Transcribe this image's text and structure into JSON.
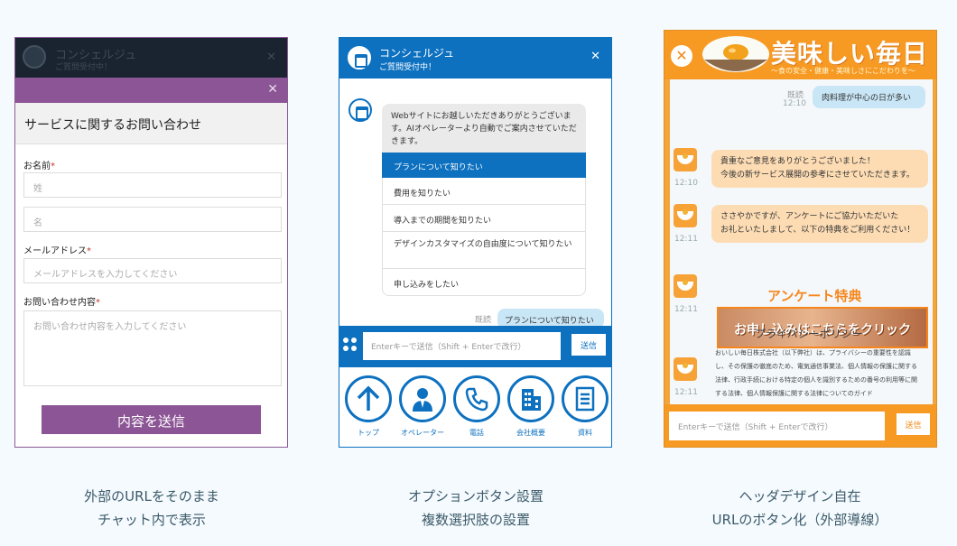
{
  "panel1": {
    "header_title": "コンシェルジュ",
    "header_status": "ご質問受付中！",
    "form_title": "サービスに関するお問い合わせ",
    "name_label": "お名前",
    "required_mark": "*",
    "last_name_placeholder": "姓",
    "first_name_placeholder": "名",
    "email_label": "メールアドレス",
    "email_placeholder": "メールアドレスを入力してください",
    "inquiry_label": "お問い合わせ内容",
    "inquiry_placeholder": "お問い合わせ内容を入力してください",
    "submit_label": "内容を送信",
    "close_glyph": "✕",
    "accent_color": "#8c5595"
  },
  "panel2": {
    "header_title": "コンシェルジュ",
    "header_status": "ご質問受付中！",
    "close_glyph": "✕",
    "bot_message": "Webサイトにお越しいただきありがとうございます。AIオペレーターより自動でご案内させていただきます。",
    "options": [
      "プランについて知りたい",
      "費用を知りたい",
      "導入までの期間を知りたい",
      "デザインカスタマイズの自由度について知りたい",
      "申し込みをしたい"
    ],
    "selected_option": 0,
    "user_label": "既読",
    "user_message": "プランについて知りたい",
    "input_placeholder": "Enterキーで送信（Shift + Enterで改行）",
    "send_label": "送信",
    "tiles": [
      {
        "label": "トップ",
        "icon": "arrow-up-icon"
      },
      {
        "label": "オペレーター",
        "icon": "operator-icon"
      },
      {
        "label": "電話",
        "icon": "phone-icon"
      },
      {
        "label": "会社概要",
        "icon": "building-icon"
      },
      {
        "label": "資料",
        "icon": "document-icon"
      }
    ],
    "accent_color": "#0d71c0"
  },
  "panel3": {
    "brand_title": "美味しい毎日",
    "tagline": "〜食の安全・健康・美味しさにこだわりを〜",
    "close_glyph": "✕",
    "messages": [
      {
        "from": "user",
        "read": "既読",
        "time": "12:10",
        "text": "肉料理が中心の日が多い"
      },
      {
        "from": "bot",
        "time": "12:10",
        "text": "貴重なご意見をありがとうございました！\n今後の新サービス展開の参考にさせていただきます。"
      },
      {
        "from": "bot",
        "time": "12:11",
        "text": "ささやかですが、アンケートにご協力いただいた\nお礼といたしまして、以下の特典をご利用ください！"
      },
      {
        "from": "bot",
        "time": "12:11"
      },
      {
        "from": "bot",
        "time": "12:11"
      }
    ],
    "survey_title": "アンケート特典",
    "banner_text": "お申し込みはこちらをクリック",
    "privacy_title": "プライバシーポリシー",
    "privacy_body": "おいしい毎日株式会社（以下弊社）は、プライバシーの重要性を認識し、その保護の徹底のため、電気通信事業法、個人情報の保護に関する法律、行政手続における特定の個人を識別するための番号の利用等に関する法律、個人情報保護に関する法律についてのガイド",
    "input_placeholder": "Enterキーで送信（Shift + Enterで改行）",
    "send_label": "送信",
    "accent_color": "#f79a24"
  },
  "captions": [
    [
      "外部のURLをそのまま",
      "チャット内で表示"
    ],
    [
      "オプションボタン設置",
      "複数選択肢の設置"
    ],
    [
      "ヘッダデザイン自在",
      "URLのボタン化（外部導線）"
    ]
  ]
}
